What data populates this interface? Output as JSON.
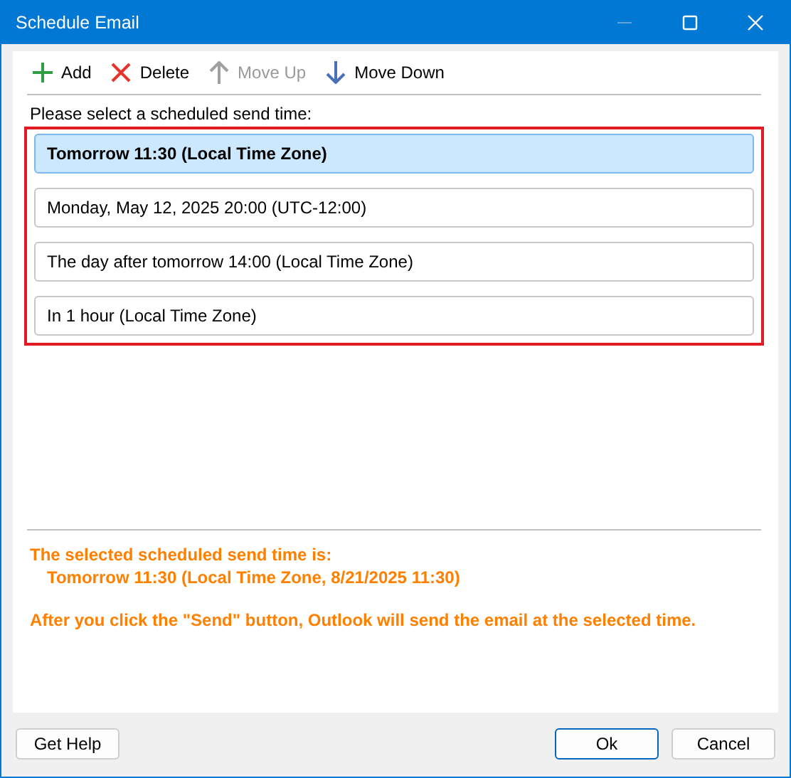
{
  "window": {
    "title": "Schedule Email",
    "minimize_disabled": true
  },
  "toolbar": [
    {
      "kind": "add",
      "label": "Add",
      "disabled": false
    },
    {
      "kind": "delete",
      "label": "Delete",
      "disabled": false
    },
    {
      "kind": "up",
      "label": "Move Up",
      "disabled": true
    },
    {
      "kind": "down",
      "label": "Move Down",
      "disabled": false
    }
  ],
  "prompt": "Please select a scheduled send time:",
  "times": [
    {
      "label": "Tomorrow 11:30 (Local Time Zone)",
      "selected": true
    },
    {
      "label": "Monday, May 12, 2025 20:00 (UTC-12:00)",
      "selected": false
    },
    {
      "label": "The day after tomorrow 14:00 (Local Time Zone)",
      "selected": false
    },
    {
      "label": "In 1 hour (Local Time Zone)",
      "selected": false
    }
  ],
  "info": {
    "heading": "The selected scheduled send time is:",
    "value": "Tomorrow 11:30 (Local Time Zone, 8/21/2025 11:30)",
    "note": "After you click the \"Send\" button, Outlook will send the email at the selected time."
  },
  "buttons": {
    "help": "Get Help",
    "ok": "Ok",
    "cancel": "Cancel"
  }
}
